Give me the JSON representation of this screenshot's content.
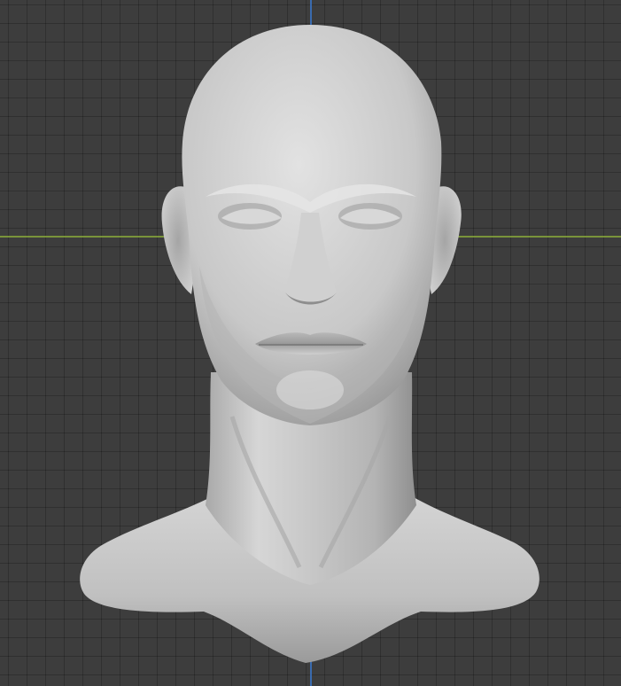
{
  "viewport": {
    "background_color": "#3d3d3d",
    "grid": true,
    "grid_line_color": "#2c2c2c"
  },
  "axes": {
    "x_axis_color": "#8db03a",
    "y_axis_color": "#3a7bd5"
  },
  "model": {
    "material_color": "#c9c9c9",
    "shading": "solid"
  }
}
